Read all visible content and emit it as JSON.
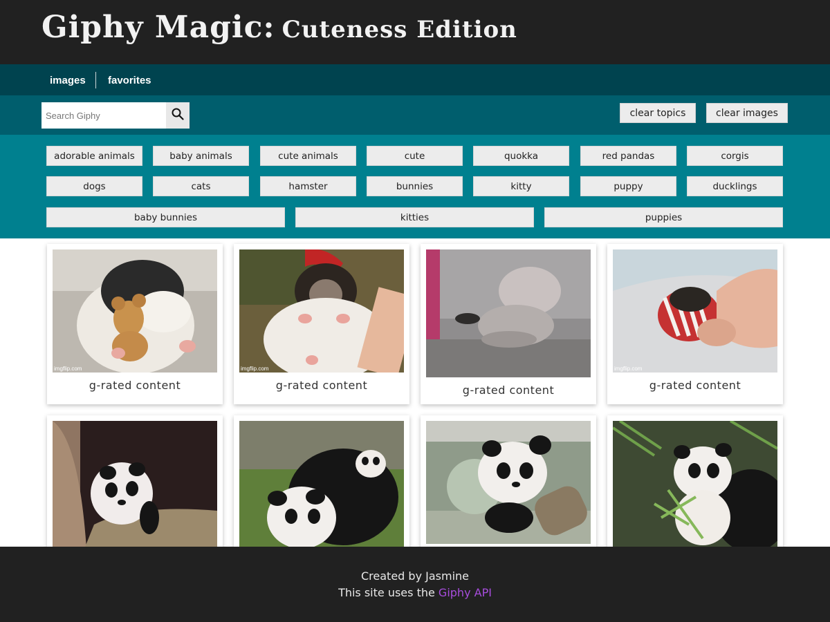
{
  "header": {
    "title_main": "Giphy Magic:",
    "title_sub": "Cuteness Edition"
  },
  "nav": {
    "items": [
      "images",
      "favorites"
    ]
  },
  "search": {
    "placeholder": "Search Giphy",
    "value": "",
    "icon": "search-icon"
  },
  "actions": {
    "clear_topics": "clear topics",
    "clear_images": "clear images"
  },
  "topics": [
    "adorable animals",
    "baby animals",
    "cute animals",
    "cute",
    "quokka",
    "red pandas",
    "corgis",
    "dogs",
    "cats",
    "hamster",
    "bunnies",
    "kitty",
    "puppy",
    "ducklings",
    "baby bunnies",
    "kitties",
    "puppies"
  ],
  "gallery": {
    "cards": [
      {
        "caption": "g-rated content",
        "watermark": "imgflip.com",
        "subject": "hamster-with-teddy-bear"
      },
      {
        "caption": "g-rated content",
        "watermark": "imgflip.com",
        "subject": "hamster-in-hand"
      },
      {
        "caption": "g-rated content",
        "watermark": "",
        "subject": "kitten"
      },
      {
        "caption": "g-rated content",
        "watermark": "imgflip.com",
        "subject": "hamster-in-sweater"
      },
      {
        "caption": "",
        "watermark": "",
        "subject": "panda-cub-in-den"
      },
      {
        "caption": "",
        "watermark": "",
        "subject": "panda-cubs-playing"
      },
      {
        "caption": "",
        "watermark": "",
        "subject": "panda-cub-with-ball"
      },
      {
        "caption": "",
        "watermark": "",
        "subject": "panda-cub-in-bamboo"
      }
    ]
  },
  "footer": {
    "created_by": "Created by Jasmine",
    "uses_prefix": "This site uses the",
    "link_text": "Giphy API"
  },
  "colors": {
    "header_bg": "#212121",
    "nav_bg": "#00434f",
    "search_bg": "#005e6d",
    "topics_bg": "#00808f",
    "button_bg": "#ececec",
    "link": "#a84dde"
  }
}
